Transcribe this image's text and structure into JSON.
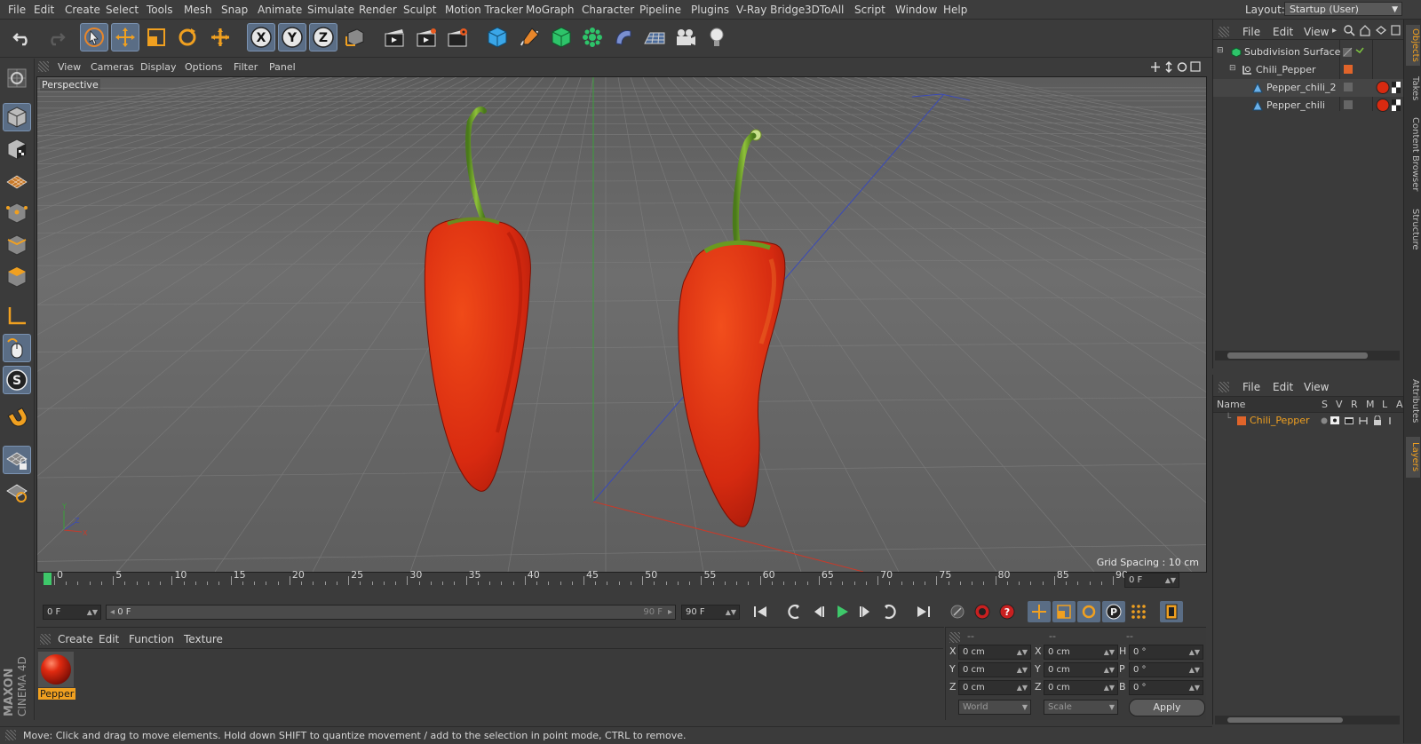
{
  "menu": [
    "File",
    "Edit",
    "Create",
    "Select",
    "Tools",
    "Mesh",
    "Snap",
    "Animate",
    "Simulate",
    "Render",
    "Sculpt",
    "Motion Tracker",
    "MoGraph",
    "Character",
    "Pipeline",
    "Plugins",
    "V-Ray Bridge",
    "3DToAll",
    "Script",
    "Window",
    "Help"
  ],
  "layout": {
    "label": "Layout:",
    "value": "Startup (User)"
  },
  "toolbar": {
    "undo": "undo-icon",
    "redo": "redo-icon",
    "select": "live-selection-icon",
    "move": "move-icon",
    "scale": "scale-icon",
    "rotate": "rotate-icon",
    "recent": "recent-tool-icon",
    "x_axis": "X",
    "y_axis": "Y",
    "z_axis": "Z"
  },
  "viewport_menu": [
    "View",
    "Cameras",
    "Display",
    "Options",
    "Filter",
    "Panel"
  ],
  "viewport": {
    "label": "Perspective",
    "grid_spacing": "Grid Spacing : 10 cm"
  },
  "timeline": {
    "ticks": [
      "0",
      "5",
      "10",
      "15",
      "20",
      "25",
      "30",
      "35",
      "40",
      "45",
      "50",
      "55",
      "60",
      "65",
      "70",
      "75",
      "80",
      "85",
      "90"
    ],
    "current_frame": "0 F"
  },
  "playback": {
    "start_field": "0 F",
    "slider_start": "0 F",
    "slider_end": "90 F",
    "end_field": "90 F"
  },
  "material_menu": [
    "Create",
    "Edit",
    "Function",
    "Texture"
  ],
  "material": {
    "name": "Pepper"
  },
  "coords": {
    "header": [
      "--",
      "--",
      "--"
    ],
    "rows": [
      {
        "a": "X",
        "av": "0 cm",
        "b": "X",
        "bv": "0 cm",
        "c": "H",
        "cv": "0 °"
      },
      {
        "a": "Y",
        "av": "0 cm",
        "b": "Y",
        "bv": "0 cm",
        "c": "P",
        "cv": "0 °"
      },
      {
        "a": "Z",
        "av": "0 cm",
        "b": "Z",
        "bv": "0 cm",
        "c": "B",
        "cv": "0 °"
      }
    ],
    "world": "World",
    "scale": "Scale",
    "apply": "Apply"
  },
  "status": "Move: Click and drag to move elements. Hold down SHIFT to quantize movement / add to the selection in point mode, CTRL to remove.",
  "objects_menu": [
    "File",
    "Edit",
    "View"
  ],
  "objects": [
    {
      "name": "Subdivision Surface",
      "indent": 0
    },
    {
      "name": "Chili_Pepper",
      "indent": 1
    },
    {
      "name": "Pepper_chili_2",
      "indent": 2
    },
    {
      "name": "Pepper_chili",
      "indent": 2
    }
  ],
  "layers_menu": [
    "File",
    "Edit",
    "View"
  ],
  "layers": {
    "columns": [
      "Name",
      "S",
      "V",
      "R",
      "M",
      "L",
      "A"
    ],
    "rows": [
      {
        "name": "Chili_Pepper",
        "color": "#e0642a"
      }
    ]
  },
  "side_tabs": [
    "Objects",
    "Takes",
    "Content Browser",
    "Structure",
    "Attributes",
    "Layers"
  ],
  "brand": {
    "maxon": "MAXON",
    "product": "CINEMA 4D"
  },
  "colors": {
    "accent": "#5a6d85",
    "layer_orange": "#e0642a",
    "pepper_red": "#d82a10",
    "axis_x": "#c83a2a",
    "axis_y": "#3a9a3a",
    "axis_z": "#3a4ab0"
  }
}
